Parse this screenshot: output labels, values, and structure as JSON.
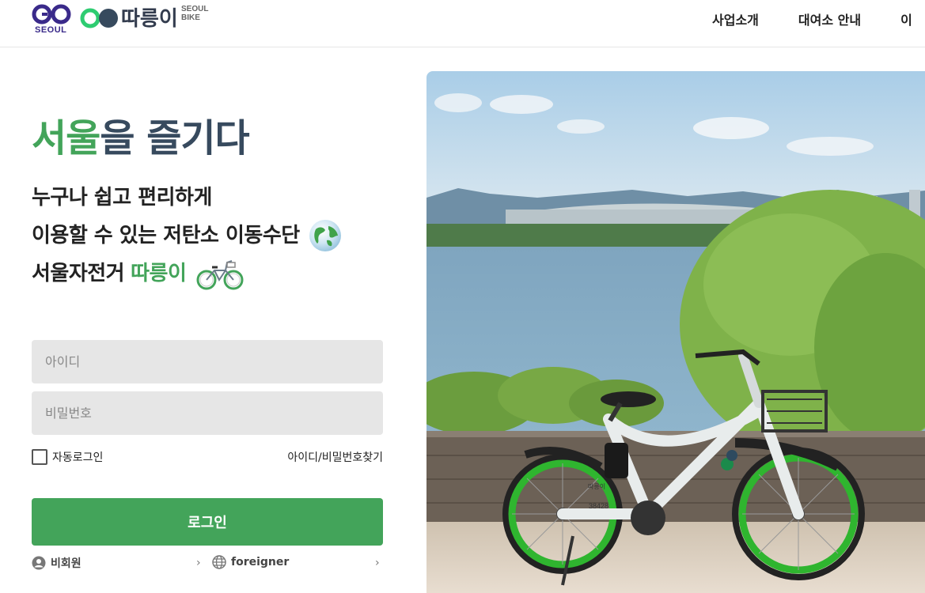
{
  "header": {
    "go_logo_text": "SEOUL",
    "brand_name": "따릉이",
    "brand_sub_1": "SEOUL",
    "brand_sub_2": "BIKE",
    "nav": [
      "사업소개",
      "대여소 안내",
      "이"
    ]
  },
  "hero": {
    "title_accent": "서울",
    "title_rest": "을 즐기다",
    "line1": "누구나 쉽고 편리하게",
    "line2": "이용할 수 있는 저탄소 이동수단",
    "line3_prefix": "서울자전거",
    "line3_brand": "따릉이"
  },
  "login": {
    "id_placeholder": "아이디",
    "pw_placeholder": "비밀번호",
    "auto_login": "자동로그인",
    "find_link": "아이디/비밀번호찾기",
    "button": "로그인"
  },
  "links": {
    "guest": "비회원",
    "foreigner": "foreigner",
    "chevron": "›"
  },
  "photo": {
    "bike_number": "38428",
    "bike_brand": "따릉이"
  },
  "colors": {
    "accent_green": "#43a45a",
    "title_navy": "#374a5e",
    "field_bg": "#e6e6e6",
    "go_purple": "#3a2a8a",
    "ddr_green": "#2ecc71"
  },
  "icons": [
    "go-seoul-logo",
    "ddareungi-logo",
    "globe-icon",
    "bike-icon",
    "user-icon",
    "globe-small-icon",
    "chevron-right-icon"
  ]
}
